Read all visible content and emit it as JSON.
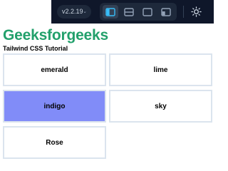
{
  "toolbar": {
    "version_label": "v2.2.19",
    "layout_buttons": [
      {
        "icon": "split-vertical-icon",
        "active": true
      },
      {
        "icon": "split-horizontal-icon",
        "active": false
      },
      {
        "icon": "preview-only-icon",
        "active": false
      },
      {
        "icon": "sidebar-layout-icon",
        "active": false
      }
    ],
    "theme_icon": "sun-icon"
  },
  "page": {
    "title": "Geeksforgeeks",
    "subtitle": "Tailwind CSS Tutorial"
  },
  "grid": {
    "items": [
      {
        "label": "emerald",
        "color": "#ffffff"
      },
      {
        "label": "lime",
        "color": "#ffffff"
      },
      {
        "label": "indigo",
        "color": "#818cf8"
      },
      {
        "label": "sky",
        "color": "#ffffff"
      },
      {
        "label": "Rose",
        "color": "#ffffff"
      }
    ]
  },
  "colors": {
    "title_green": "#22a06b",
    "toolbar_bg": "#0f172a",
    "card_border": "#dbe4ee"
  }
}
